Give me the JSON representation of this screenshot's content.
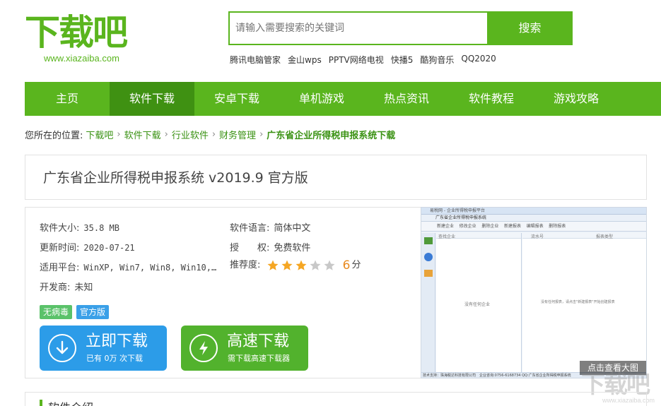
{
  "header": {
    "logo_cn": "下载吧",
    "logo_en": "www.xiazaiba.com",
    "search_placeholder": "请输入需要搜索的关键词",
    "search_button": "搜索",
    "hot_links": [
      "腾讯电脑管家",
      "金山wps",
      "PPTV网络电视",
      "快播5",
      "酷狗音乐",
      "QQ2020"
    ]
  },
  "nav": {
    "items": [
      "主页",
      "软件下载",
      "安卓下载",
      "单机游戏",
      "热点资讯",
      "软件教程",
      "游戏攻略"
    ],
    "active_index": 1
  },
  "breadcrumb": {
    "label": "您所在的位置:",
    "links": [
      "下载吧",
      "软件下载",
      "行业软件",
      "财务管理"
    ],
    "separator": "›",
    "current": "广东省企业所得税申报系统下载"
  },
  "software": {
    "title": "广东省企业所得税申报系统 v2019.9 官方版",
    "size_label": "软件大小:",
    "size_value": "35.8 MB",
    "lang_label": "软件语言:",
    "lang_value": "简体中文",
    "updated_label": "更新时间:",
    "updated_value": "2020-07-21",
    "license_label": "授　　权:",
    "license_value": "免费软件",
    "platform_label": "适用平台:",
    "platform_value": "WinXP, Win7, Win8, Win10,…",
    "rating_label": "推荐度:",
    "rating_score": "6",
    "rating_unit": "分",
    "rating_stars": 3,
    "rating_max": 5,
    "developer_label": "开发商:",
    "developer_value": "未知",
    "tags": [
      "无病毒",
      "官方版"
    ]
  },
  "download": {
    "primary_label": "立即下载",
    "primary_sub": "已有 0万 次下载",
    "fast_label": "高速下载",
    "fast_sub": "需下载高速下载器"
  },
  "screenshot": {
    "app_title": "易税网 - 企业所得税申报平台",
    "tab_label": "广东省企业所得税申报系统",
    "toolbar_items": [
      "新建企业",
      "修改企业",
      "删除企业",
      "新建报表",
      "编辑报表",
      "删除报表"
    ],
    "left_header": "查找企业",
    "left_empty": "没有任何企业",
    "col_serial": "流水号",
    "col_type": "报表类型",
    "right_empty": "没有任何报表，请点击\"新建报表\"开始创建报表",
    "status_text": "技术支持：珠海税达科技有限公司　企业咨询:0756-6168734 QQ:广东省企业所得税申报系统",
    "overlay_label": "点击查看大图"
  },
  "watermark": {
    "cn": "下载吧",
    "en": "www.xiazaiba.com"
  },
  "intro": {
    "title": "软件介绍"
  },
  "colors": {
    "brand_green": "#5ab51e",
    "nav_active": "#3f9112",
    "download_blue": "#2c9ce8",
    "download_green": "#52b22d",
    "star_fill": "#f5a623",
    "score_orange": "#e88a20"
  }
}
